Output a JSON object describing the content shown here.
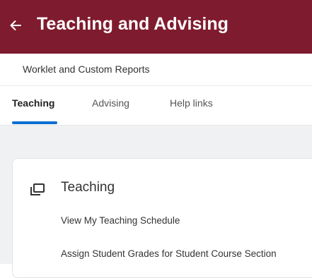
{
  "header": {
    "title": "Teaching and Advising",
    "background_color": "#7f1b2e",
    "back_icon": "arrow-left-icon"
  },
  "subheader": {
    "title": "Worklet and Custom Reports"
  },
  "tabs": [
    {
      "label": "Teaching",
      "active": true
    },
    {
      "label": "Advising",
      "active": false
    },
    {
      "label": "Help links",
      "active": false
    }
  ],
  "accent_color": "#0a6ed1",
  "card": {
    "icon": "window-stack-icon",
    "title": "Teaching",
    "links": [
      {
        "label": "View My Teaching Schedule"
      },
      {
        "label": "Assign Student Grades for Student Course Section"
      }
    ]
  }
}
